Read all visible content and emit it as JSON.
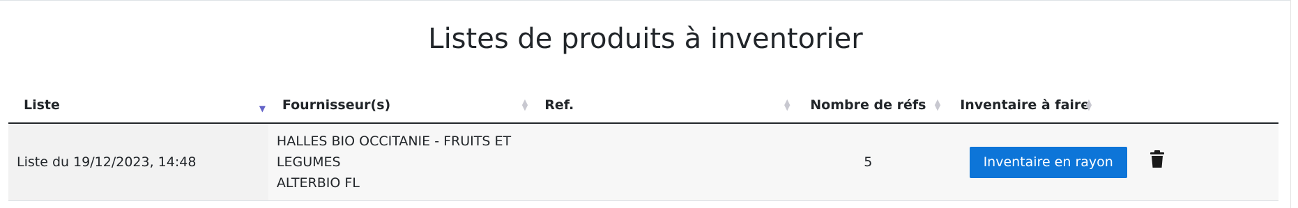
{
  "page": {
    "title": "Listes de produits à inventorier"
  },
  "table": {
    "columns": [
      {
        "label": "Liste",
        "sorted": "desc"
      },
      {
        "label": "Fournisseur(s)",
        "sorted": "none"
      },
      {
        "label": "Ref.",
        "sorted": "none"
      },
      {
        "label": "Nombre de réfs",
        "sorted": "none"
      },
      {
        "label": "Inventaire à faire",
        "sorted": "none"
      },
      {
        "label": "",
        "sorted": "none"
      }
    ],
    "rows": [
      {
        "liste": "Liste du 19/12/2023, 14:48",
        "fournisseurs": [
          "HALLES BIO OCCITANIE - FRUITS ET",
          "LEGUMES",
          "ALTERBIO FL"
        ],
        "ref": "",
        "nombre_refs": "5",
        "action_label": "Inventaire en rayon",
        "delete_icon": "trash-icon"
      }
    ]
  },
  "colors": {
    "primary": "#0d75d8",
    "sort_active": "#6464c8",
    "sort_inactive": "#c8c8d0"
  }
}
